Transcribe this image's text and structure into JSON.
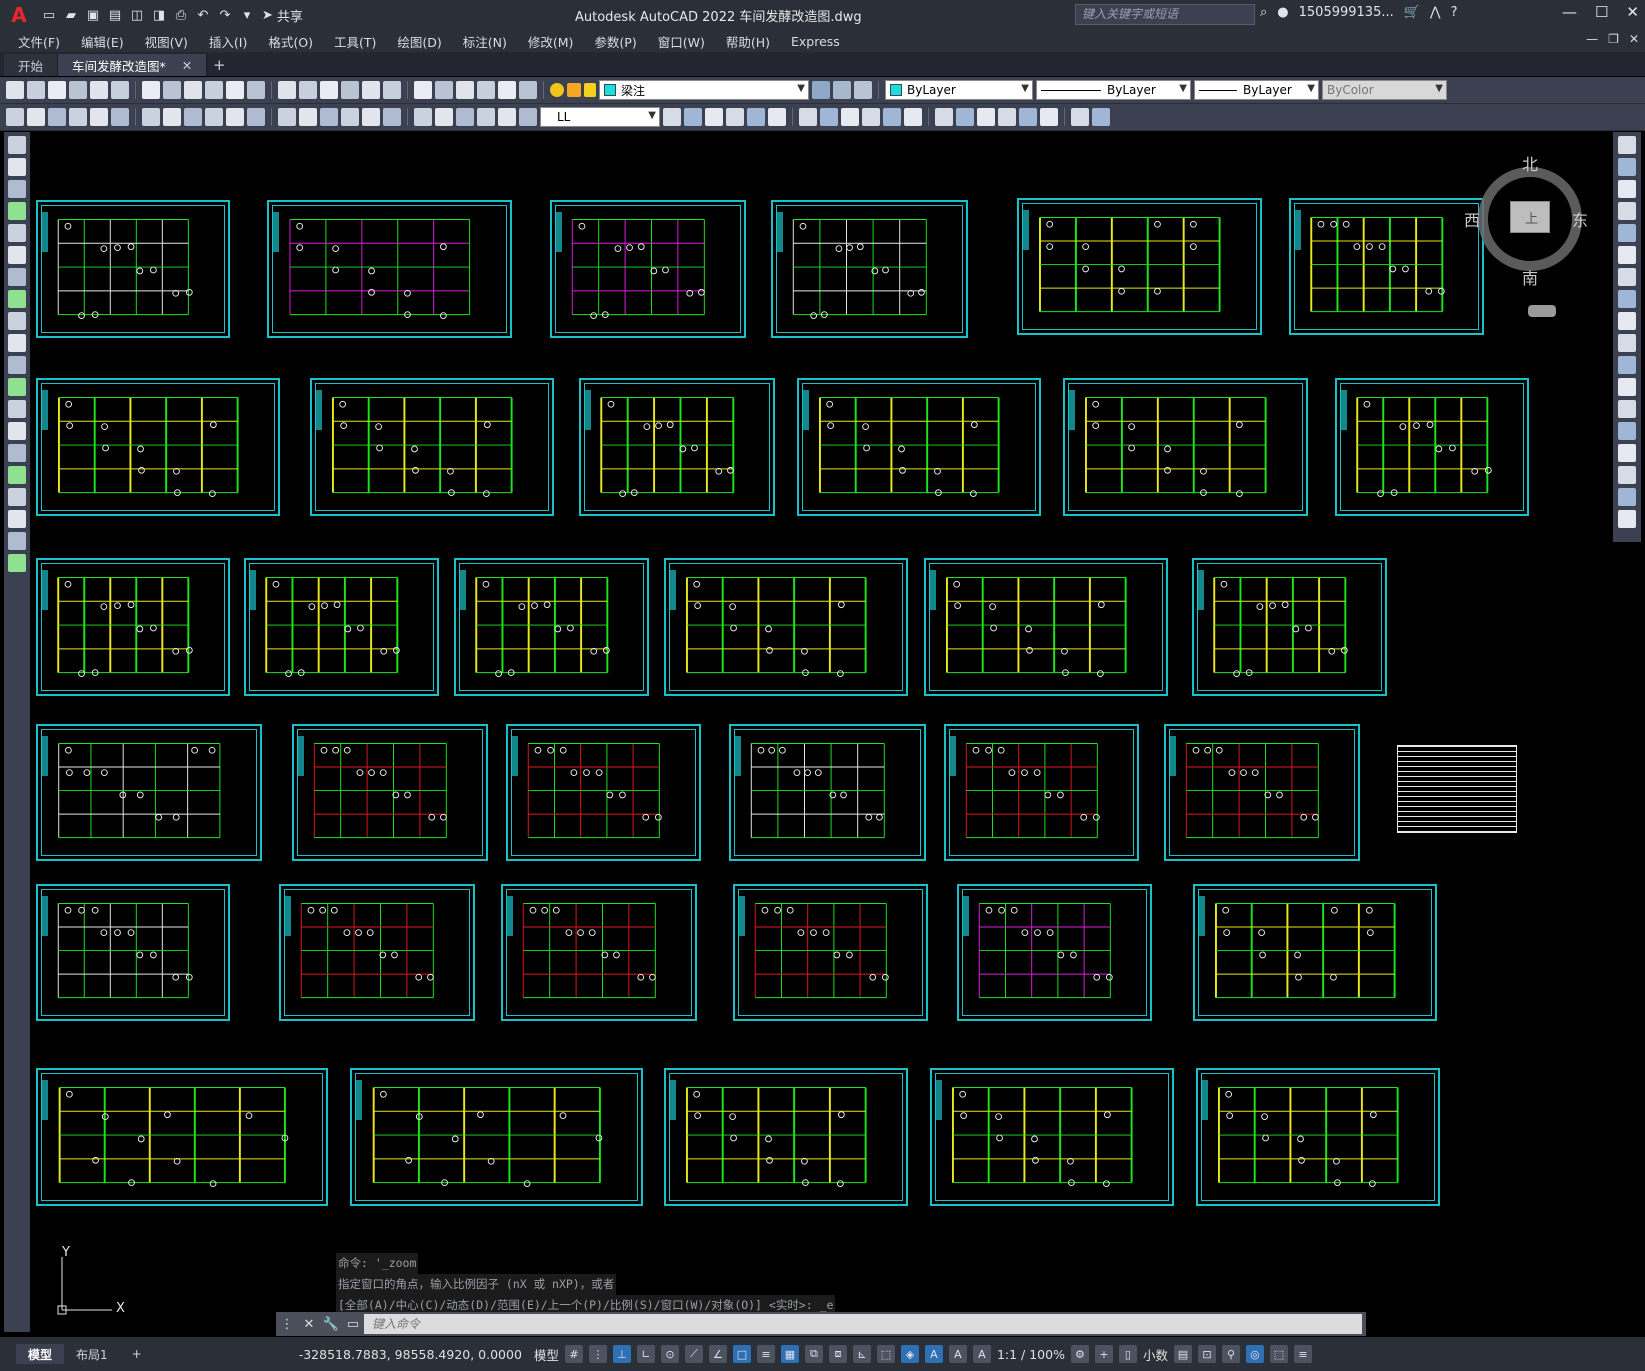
{
  "titlebar": {
    "app_logo": "A",
    "share_label": "共享",
    "title": "Autodesk AutoCAD 2022    车间发酵改造图.dwg",
    "search_placeholder": "键入关键字或短语",
    "user": "1505999135...",
    "help": "?"
  },
  "menu": [
    "文件(F)",
    "编辑(E)",
    "视图(V)",
    "插入(I)",
    "格式(O)",
    "工具(T)",
    "绘图(D)",
    "标注(N)",
    "修改(M)",
    "参数(P)",
    "窗口(W)",
    "帮助(H)",
    "Express"
  ],
  "tabs": {
    "start": "开始",
    "active": "车间发酵改造图*",
    "add": "+"
  },
  "toolbar1": {
    "layer": "梁注",
    "color": "ByLayer",
    "linetype": "ByLayer",
    "lineweight": "ByLayer",
    "plotstyle": "ByColor"
  },
  "toolbar2": {
    "dimstyle": "LL"
  },
  "viewcube": {
    "north": "北",
    "south": "南",
    "east": "东",
    "west": "西",
    "face": "上"
  },
  "ucs": {
    "y_label": "Y",
    "x_label": "X"
  },
  "command": {
    "history": [
      "命令: '_zoom",
      "指定窗口的角点，输入比例因子 (nX 或 nXP)，或者",
      "[全部(A)/中心(C)/动态(D)/范围(E)/上一个(P)/比例(S)/窗口(W)/对象(O)] <实时>: _e"
    ],
    "placeholder": "键入命令"
  },
  "status": {
    "layout_model": "模型",
    "layout1": "布局1",
    "add": "+",
    "coords": "-328518.7883, 98558.4920, 0.0000",
    "space": "模型",
    "scale": "1:1 / 100%",
    "units": "小数"
  },
  "colors": {
    "frame": "#19c2c8",
    "green": "#1be61b",
    "yellow": "#e8e81a",
    "magenta": "#e01ee0",
    "red": "#e01a1a",
    "white": "#e8e8e8"
  }
}
